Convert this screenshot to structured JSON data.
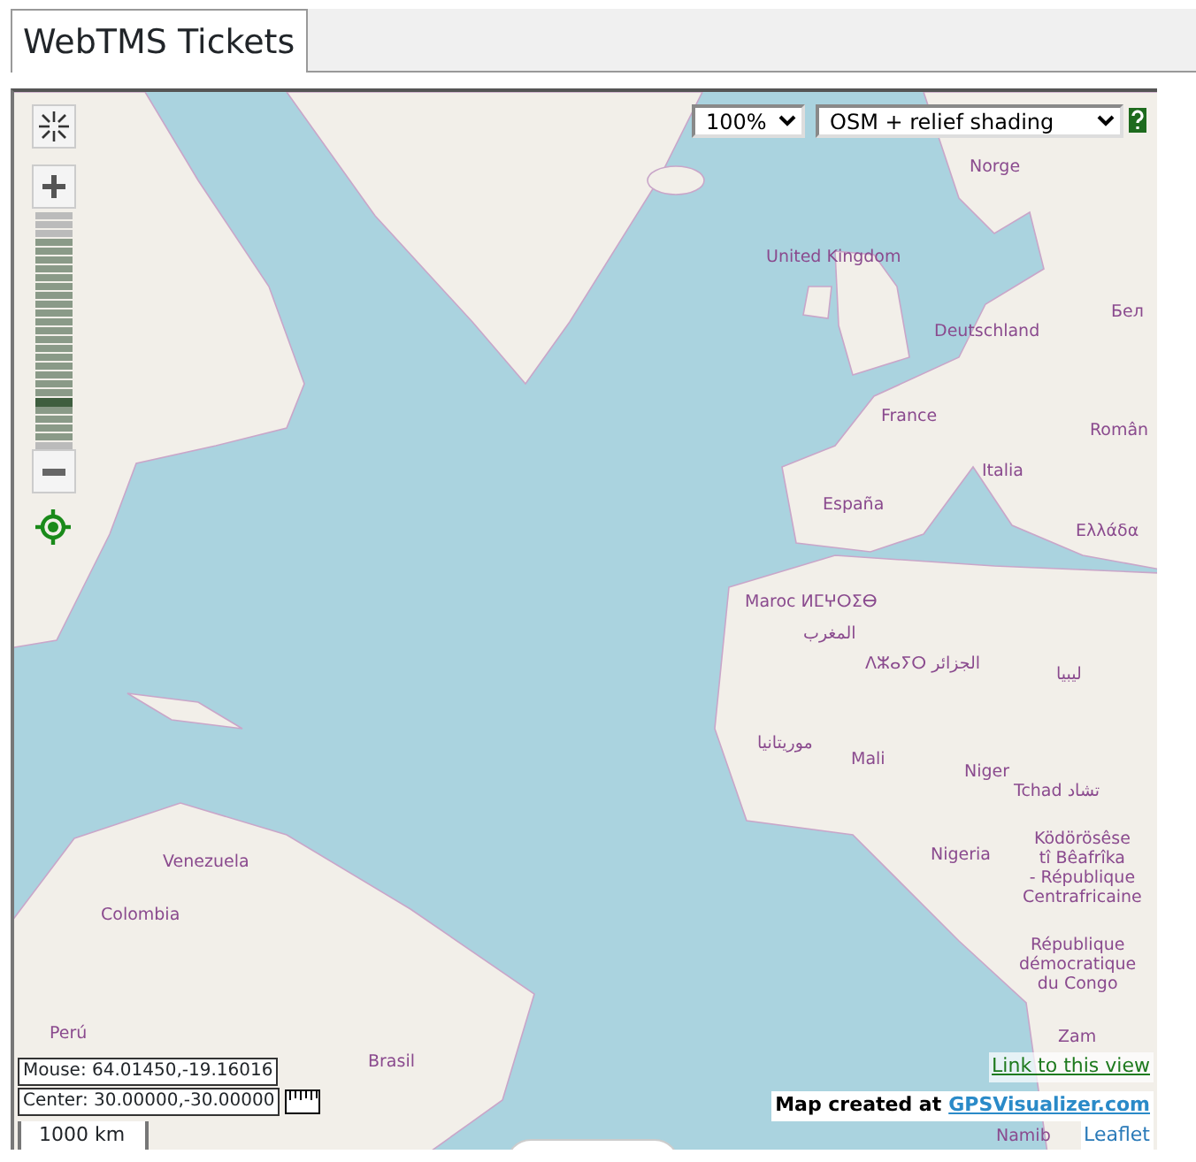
{
  "tab": {
    "label": "WebTMS Tickets",
    "selected": true
  },
  "map": {
    "zoom_select": {
      "value": "100%"
    },
    "layer_select": {
      "value": "OSM + relief shading"
    },
    "zoom_slider": {
      "level": 0.19
    },
    "labels": [
      {
        "text": "Norge"
      },
      {
        "text": "United Kingdom"
      },
      {
        "text": "Deutschland"
      },
      {
        "text": "Бел"
      },
      {
        "text": "France"
      },
      {
        "text": "Român"
      },
      {
        "text": "Italia"
      },
      {
        "text": "España"
      },
      {
        "text": "Ελλάδα"
      },
      {
        "text": "Maroc ⵍⵎⵖⵔⵉⴱ"
      },
      {
        "text": "المغرب"
      },
      {
        "text": "ⴷⵣⴰⵢⵔ الجزائر"
      },
      {
        "text": "ليبيا"
      },
      {
        "text": "موريتانيا"
      },
      {
        "text": "Mali"
      },
      {
        "text": "Niger"
      },
      {
        "text": "Tchad تشاد"
      },
      {
        "text": "Nigeria"
      },
      {
        "text": "Ködörösêse\ntî Bêafrîka\n- République\nCentrafricaine"
      },
      {
        "text": "République\ndémocratique\ndu Congo"
      },
      {
        "text": "Venezuela"
      },
      {
        "text": "Colombia"
      },
      {
        "text": "Perú"
      },
      {
        "text": "Brasil"
      },
      {
        "text": "Zam"
      },
      {
        "text": "Namib"
      }
    ],
    "mouse_readout": "Mouse: 64.01450,-19.16016",
    "center_readout": "Center: 30.00000,-30.00000",
    "scale": "1000 km",
    "link": "Link to this view",
    "credit_prefix": "Map created at",
    "credit_link": "GPSVisualizer.com",
    "attribution": "Leaflet"
  }
}
